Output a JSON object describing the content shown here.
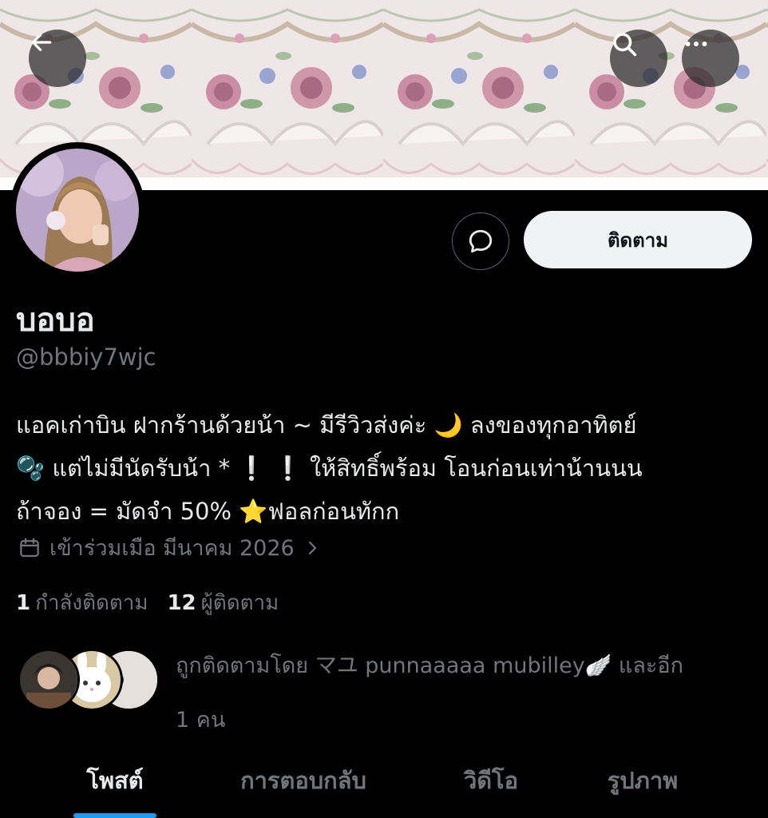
{
  "header": {
    "back_icon": "arrow-left-icon",
    "search_icon": "search-icon",
    "more_icon": "more-horizontal-icon"
  },
  "profile": {
    "display_name": "บอบอ",
    "handle": "@bbbiy7wjc",
    "follow_label": "ติดตาม",
    "message_icon": "message-bubble-icon",
    "bio_lines": [
      "แอคเก่าบิน ฝากร้านด้วยน้า ~ มีรีวิวส่งค่ะ 🌙 ลงของทุกอาทิตย์",
      "🫧 แต่ไม่มีนัดรับน้า * ❕ ❕  ให้สิทธิ์พร้อม โอนก่อนเท่าน้านนน",
      "ถ้าจอง = มัดจำ 50% ⭐ฟอลก่อนทักก"
    ],
    "joined_text": "เข้าร่วมเมือ มีนาคม 2026",
    "following_count": "1",
    "following_label": "กำลังติดตาม",
    "followers_count": "12",
    "followers_label": "ผู้ติดตาม",
    "followed_by_line1": "ถูกติดตามโดย マユ punnaaaaa mubilley🪽 และอีก",
    "followed_by_line2": "1 คน"
  },
  "tabs": [
    {
      "label": "โพสต์",
      "active": true
    },
    {
      "label": "การตอบกลับ",
      "active": false
    },
    {
      "label": "วิดีโอ",
      "active": false
    },
    {
      "label": "รูปภาพ",
      "active": false
    }
  ],
  "colors": {
    "background": "#000000",
    "accent": "#1d9bf0",
    "text_primary": "#e7e9ea",
    "text_secondary": "#71767b"
  }
}
